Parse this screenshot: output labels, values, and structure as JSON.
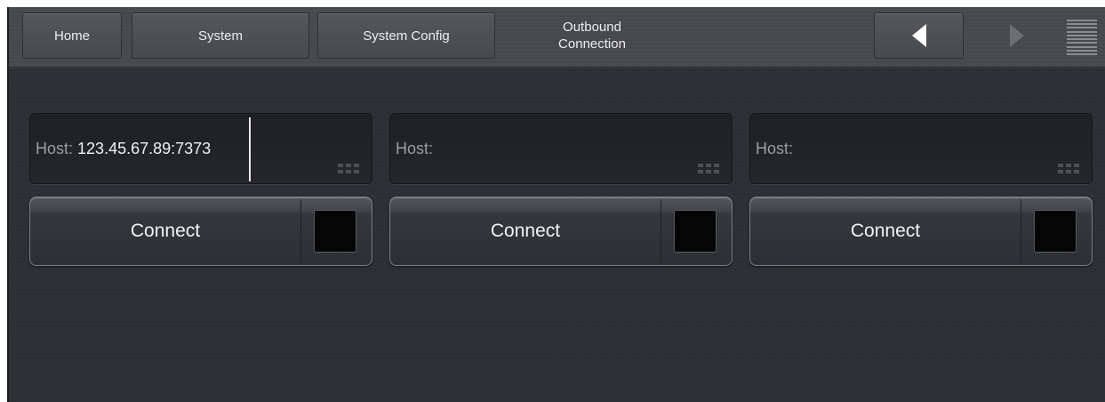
{
  "nav": {
    "home": "Home",
    "system": "System",
    "system_config": "System Config",
    "current_line1": "Outbound",
    "current_line2": "Connection",
    "prev_icon": "triangle-left-icon",
    "next_icon": "triangle-right-icon",
    "menu_icon": "menu-lines-icon"
  },
  "connections": [
    {
      "host_label": "Host:",
      "host_value": "123.45.67.89:7373",
      "button_label": "Connect",
      "status_color": "#050505"
    },
    {
      "host_label": "Host:",
      "host_value": "",
      "button_label": "Connect",
      "status_color": "#050505"
    },
    {
      "host_label": "Host:",
      "host_value": "",
      "button_label": "Connect",
      "status_color": "#050505"
    }
  ],
  "colors": {
    "background": "#2e3136",
    "topbar": "#4a4c4f",
    "text": "#f0f1f3",
    "placeholder": "#9c9ea2"
  }
}
